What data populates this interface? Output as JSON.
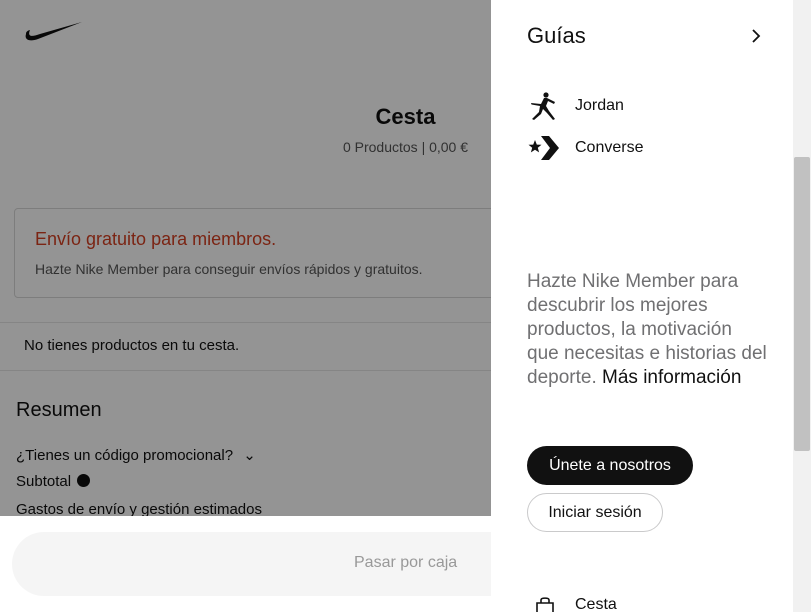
{
  "page": {
    "cart_title": "Cesta",
    "cart_subtitle": "0 Productos | 0,00 €",
    "promo": {
      "title": "Envío gratuito para miembros.",
      "text": "Hazte Nike Member para conseguir envíos rápidos y gratuitos."
    },
    "empty_cart": "No tienes productos en tu cesta.",
    "summary": {
      "title": "Resumen",
      "promo_code": "¿Tienes un código promocional?",
      "subtotal": "Subtotal",
      "shipping": "Gastos de envío y gestión estimados"
    },
    "checkout_label": "Pasar por caja"
  },
  "drawer": {
    "guides_label": "Guías",
    "brands": [
      {
        "label": "Jordan",
        "icon": "jordan-jumpman-icon"
      },
      {
        "label": "Converse",
        "icon": "converse-star-chevron-icon"
      }
    ],
    "member_text": "Hazte Nike Member para descubrir los mejores productos, la motivación que necesitas e historias del deporte.",
    "member_more": "Más información",
    "join_label": "Únete a nosotros",
    "login_label": "Iniciar sesión",
    "bag_label": "Cesta"
  },
  "colors": {
    "promo_accent": "#d43f21",
    "primary_button": "#111111",
    "muted_text": "#707072"
  }
}
